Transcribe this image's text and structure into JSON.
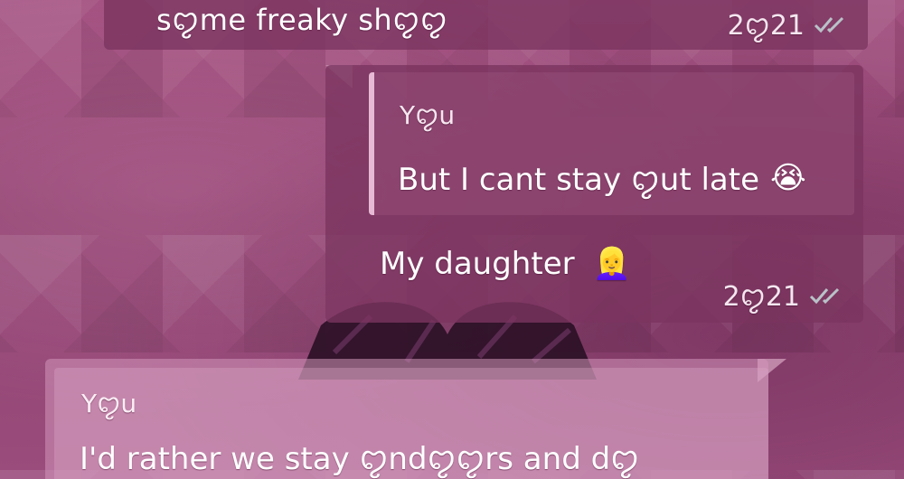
{
  "messages": {
    "top": {
      "text": "sꨄme freaky shꨄꨄ",
      "time": "2ꨄ21"
    },
    "middle": {
      "quote_author": "Yꨄu",
      "quote_text": "But I cant stay ꨄut late",
      "quote_emoji": "😭",
      "text": "My daughter",
      "emoji": "👱‍♀️",
      "time": "2ꨄ21"
    },
    "bottom": {
      "quote_author": "Yꨄu",
      "quote_text": "I'd rather we stay ꨄndꨄꨄrs and dꨄ"
    }
  },
  "colors": {
    "wallpaper": "#9a4c7c",
    "bubble_dark": "#7a345f",
    "bubble_light": "#d296b9",
    "quote_bar": "#e7b9d5"
  },
  "icons": {
    "read_receipt": "double-check-icon"
  }
}
